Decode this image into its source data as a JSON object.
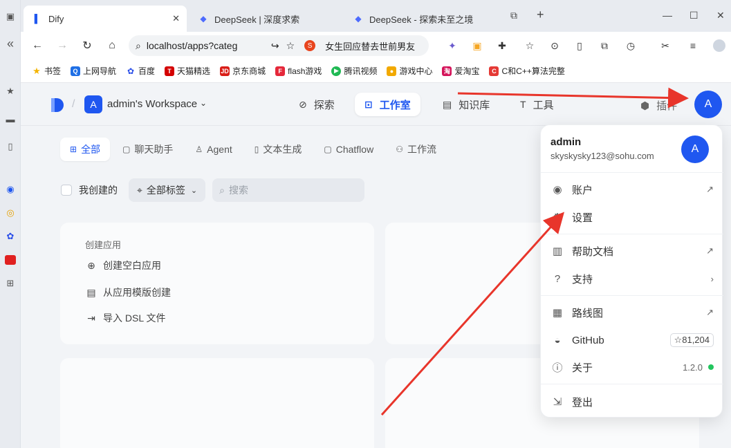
{
  "browser": {
    "tabs": [
      {
        "title": "Dify",
        "icon": "dify-logo"
      },
      {
        "title": "DeepSeek | 深度求索",
        "icon": "deepseek-whale"
      },
      {
        "title": "DeepSeek - 探索未至之境",
        "icon": "deepseek-whale"
      }
    ],
    "new_tab": "+",
    "url": "localhost/apps?categ",
    "search_hint": "女生回应替去世前男友",
    "bookmarks": [
      "书签",
      "上网导航",
      "百度",
      "天猫精选",
      "京东商城",
      "flash游戏",
      "腾讯视频",
      "游戏中心",
      "爱淘宝",
      "C和C++算法完整"
    ]
  },
  "app": {
    "workspace_badge": "A",
    "workspace_name": "admin's Workspace",
    "nav": {
      "explore": "探索",
      "studio": "工作室",
      "knowledge": "知识库",
      "tools": "工具",
      "plugins": "插件"
    },
    "avatar_letter": "A",
    "filter_tabs": [
      "全部",
      "聊天助手",
      "Agent",
      "文本生成",
      "Chatflow",
      "工作流"
    ],
    "created_by_me": "我创建的",
    "all_tags": "全部标签",
    "search_placeholder": "搜索",
    "create": {
      "title": "创建应用",
      "blank": "创建空白应用",
      "template": "从应用模版创建",
      "import": "导入 DSL 文件"
    }
  },
  "menu": {
    "name": "admin",
    "email": "skyskysky123@sohu.com",
    "avatar_letter": "A",
    "items": {
      "account": "账户",
      "settings": "设置",
      "docs": "帮助文档",
      "support": "支持",
      "roadmap": "路线图",
      "github": "GitHub",
      "github_stars": "81,204",
      "about": "关于",
      "version": "1.2.0",
      "logout": "登出"
    }
  },
  "colors": {
    "accent": "#1f57f0",
    "annotation_arrow": "#e8352b",
    "status_green": "#22c55e"
  }
}
